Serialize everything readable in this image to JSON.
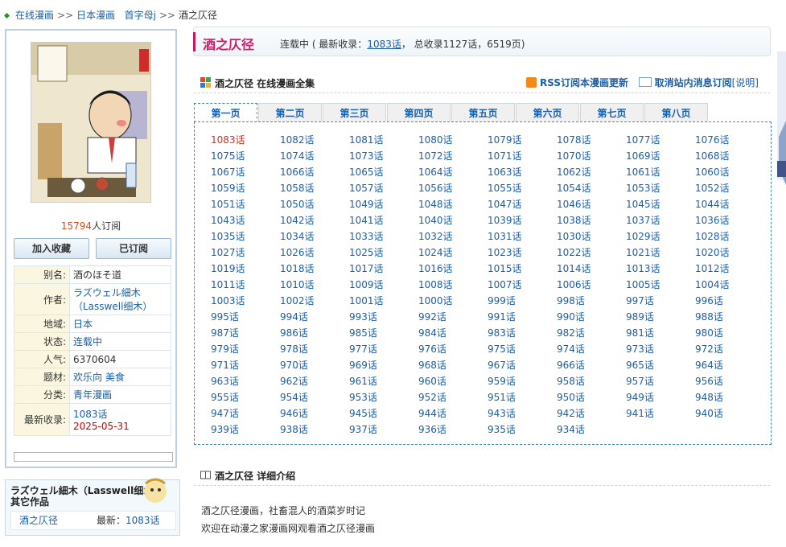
{
  "breadcrumb": {
    "items": [
      "在线漫画",
      "日本漫画",
      "首字母j"
    ],
    "separator": ">>",
    "current": "酒之仄径"
  },
  "left": {
    "subscribe_count": "15794",
    "subscribe_suffix": "人订阅",
    "btn_fav": "加入收藏",
    "btn_sub": "已订阅",
    "info": [
      {
        "k": "别名:",
        "v": "酒のほそ道"
      },
      {
        "k": "作者:",
        "v": "ラズウェル細木",
        "v2": "（Lasswell细木）"
      },
      {
        "k": "地域:",
        "v": "日本"
      },
      {
        "k": "状态:",
        "v": "连载中"
      },
      {
        "k": "人气:",
        "v": "6370604"
      },
      {
        "k": "题材:",
        "v": "欢乐向 美食"
      },
      {
        "k": "分类:",
        "v": "青年漫画"
      },
      {
        "k": "最新收录:",
        "v": "1083话",
        "v2": "2025-05-31"
      }
    ]
  },
  "author_box": {
    "title": "ラズウェル細木（Lasswell细木）其它作品",
    "work": "酒之仄径",
    "latest_label": "最新：",
    "latest": "1083话"
  },
  "title_bar": {
    "name": "酒之仄径",
    "status_pre": "连载中 ( 最新收录：",
    "latest": "1083话",
    "status_post": "， 总收录1127话，6519页)"
  },
  "chapters_section": {
    "title": "酒之仄径 在线漫画全集",
    "rss": "RSS订阅本漫画更新",
    "unsub": "取消站内消息订阅",
    "explain": "[说明]",
    "tabs": [
      "第一页",
      "第二页",
      "第三页",
      "第四页",
      "第五页",
      "第六页",
      "第七页",
      "第八页"
    ],
    "first": 1083,
    "last": 934,
    "suffix": "话"
  },
  "intro_section": {
    "title": "酒之仄径 详细介绍",
    "line1": "酒之仄径漫画，社畜混人的酒菜岁时记",
    "line2": "欢迎在动漫之家漫画网观看酒之仄径漫画"
  },
  "colors": {
    "link": "#1a5fa8",
    "title_pink": "#d21a6a",
    "latest_red": "#d12b1f",
    "count_orange": "#d44a1e",
    "tab_border": "#3d8ab8"
  }
}
